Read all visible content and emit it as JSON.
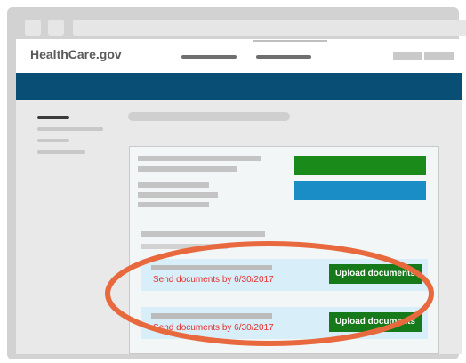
{
  "header": {
    "logo_text": "HealthCare.gov"
  },
  "documents": [
    {
      "deadline_text": "Send documents by 6/30/2017",
      "button_label": "Upload documents"
    },
    {
      "deadline_text": "Send documents by 6/30/2017",
      "button_label": "Upload documents"
    }
  ],
  "colors": {
    "navbar": "#094e75",
    "primary_green": "#1a8a1a",
    "secondary_blue": "#1a8dc7",
    "deadline_red": "#e5312f",
    "highlight_orange": "#e8693e"
  }
}
